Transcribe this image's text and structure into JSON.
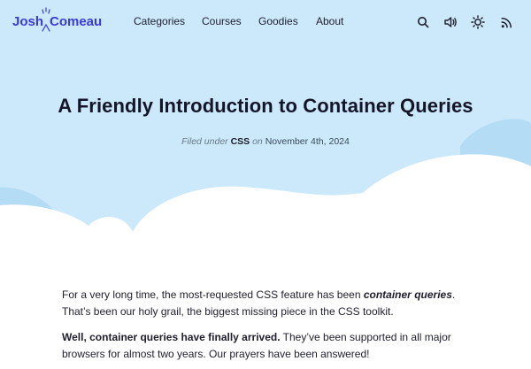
{
  "brand": {
    "first": "Josh",
    "last": "Comeau",
    "accent": "#3a3ad8"
  },
  "nav": {
    "links": [
      "Categories",
      "Courses",
      "Goodies",
      "About"
    ]
  },
  "toolbar": {
    "icons": [
      "search-icon",
      "sound-icon",
      "sun-icon",
      "rss-icon"
    ]
  },
  "post": {
    "title": "A Friendly Introduction to Container Queries",
    "filed_under": "Filed under",
    "category": "CSS",
    "on": "on",
    "date": "November 4th, 2024"
  },
  "article": {
    "p1_before": "For a very long time, the most-requested CSS feature has been ",
    "p1_em": "container queries",
    "p1_after": ". That’s been our holy grail, the biggest missing piece in the CSS toolkit.",
    "p2_strong": "Well, container queries have finally arrived.",
    "p2_after": " They’ve been supported in all major browsers for almost two years. Our prayers have been answered!"
  },
  "colors": {
    "sky": "#cbe9fb",
    "cloud": "#ffffff",
    "cloud_shadow": "#b8def6"
  }
}
